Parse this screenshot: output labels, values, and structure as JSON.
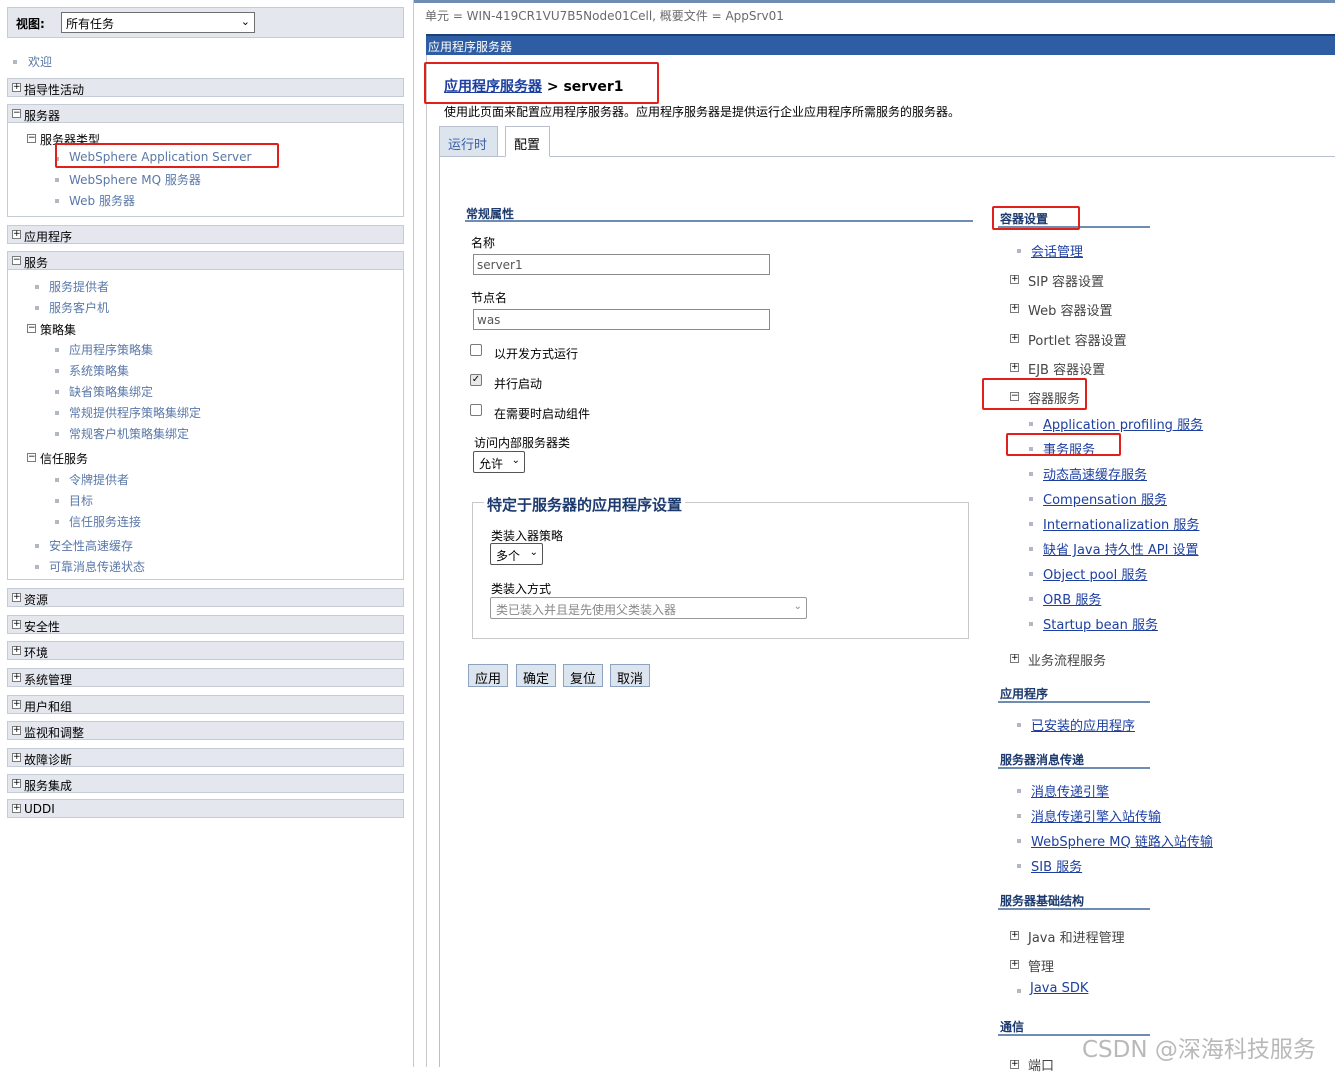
{
  "nav": {
    "view_label": "视图:",
    "view_value": "所有任务",
    "welcome": "欢迎",
    "sections": {
      "guided": "指导性活动",
      "servers": "服务器",
      "applications": "应用程序",
      "services": "服务",
      "resources": "资源",
      "security": "安全性",
      "environment": "环境",
      "sysadmin": "系统管理",
      "users": "用户和组",
      "monitoring": "监视和调整",
      "troubleshooting": "故障诊断",
      "integration": "服务集成",
      "uddi": "UDDI"
    },
    "server_types": "服务器类型",
    "server_items": [
      "WebSphere Application Server",
      "WebSphere MQ 服务器",
      "Web 服务器"
    ],
    "service_items": [
      "服务提供者",
      "服务客户机"
    ],
    "policy_sets": "策略集",
    "policy_items": [
      "应用程序策略集",
      "系统策略集",
      "缺省策略集绑定",
      "常规提供程序策略集绑定",
      "常规客户机策略集绑定"
    ],
    "trust_service": "信任服务",
    "trust_items": [
      "令牌提供者",
      "目标",
      "信任服务连接"
    ],
    "other_items": [
      "安全性高速缓存",
      "可靠消息传递状态"
    ],
    "pm_plus": "+",
    "pm_minus": "−"
  },
  "header": {
    "cell_info": "单元 = WIN-419CR1VU7B5Node01Cell, 概要文件 = AppSrv01",
    "title": "应用程序服务器",
    "breadcrumb_link": "应用程序服务器",
    "breadcrumb_sep": " > server1",
    "description": "使用此页面来配置应用程序服务器。应用程序服务器是提供运行企业应用程序所需服务的服务器。"
  },
  "tabs": {
    "runtime": "运行时",
    "config": "配置"
  },
  "general": {
    "header": "常规属性",
    "name_label": "名称",
    "name_value": "server1",
    "node_label": "节点名",
    "node_value": "was",
    "dev_mode": "以开发方式运行",
    "parallel_start": "并行启动",
    "on_demand": "在需要时启动组件",
    "internal_class_label": "访问内部服务器类",
    "internal_class_value": "允许",
    "app_settings_legend": "特定于服务器的应用程序设置",
    "classloader_policy_label": "类装入器策略",
    "classloader_policy_value": "多个",
    "classloading_mode_label": "类装入方式",
    "classloading_mode_value": "类已装入并且是先使用父类装入器",
    "checked_mark": "✓",
    "arrow": "⌄"
  },
  "buttons": {
    "apply": "应用",
    "ok": "确定",
    "reset": "复位",
    "cancel": "取消"
  },
  "right": {
    "container_settings": "容器设置",
    "session_mgmt": "会话管理",
    "sip": "SIP 容器设置",
    "web": "Web 容器设置",
    "portlet": "Portlet 容器设置",
    "ejb": "EJB 容器设置",
    "container_services": "容器服务",
    "cs_items": [
      "Application profiling 服务",
      "事务服务",
      "动态高速缓存服务",
      "Compensation 服务",
      "Internationalization 服务",
      "缺省 Java 持久性 API 设置",
      "Object pool 服务",
      "ORB 服务",
      "Startup bean 服务"
    ],
    "business_process": "业务流程服务",
    "applications_hdr": "应用程序",
    "installed_apps": "已安装的应用程序",
    "messaging_hdr": "服务器消息传递",
    "msg_items": [
      "消息传递引擎",
      "消息传递引擎入站传输",
      "WebSphere MQ 链路入站传输",
      "SIB 服务"
    ],
    "infra_hdr": "服务器基础结构",
    "java_process": "Java 和进程管理",
    "admin": "管理",
    "java_sdk": "Java SDK",
    "comm_hdr": "通信",
    "ports": "端口"
  },
  "watermark": "CSDN @深海科技服务"
}
